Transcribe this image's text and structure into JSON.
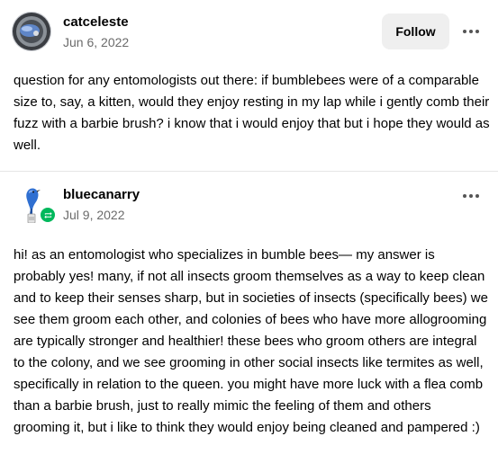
{
  "posts": [
    {
      "username": "catceleste",
      "date": "Jun 6, 2022",
      "follow_label": "Follow",
      "body": "question for any entomologists out there: if bumblebees were of a comparable size to, say, a kitten, would they enjoy resting in my lap while i gently comb their fuzz with a barbie brush? i know that i would enjoy that but i hope they would as well."
    },
    {
      "username": "bluecanarry",
      "date": "Jul 9, 2022",
      "body": "hi! as an entomologist who specializes in bumble bees— my answer is probably yes! many, if not all insects groom themselves as a way to keep clean and to keep their senses sharp, but in societies of insects (specifically bees) we see them groom each other, and colonies of bees who have more allogrooming are typically stronger and healthier! these bees who groom others are integral to the colony, and we see grooming in other social insects like termites as well, specifically in relation to the queen. you might have more luck with a flea comb than a barbie brush, just to really mimic the feeling of them and others grooming it, but i like to think they would enjoy being cleaned and pampered :)"
    }
  ],
  "icons": {
    "more": "more-horizontal-icon",
    "reblog": "reblog-icon"
  },
  "colors": {
    "reblog_badge": "#00b85c",
    "follow_button_bg": "#efefef",
    "date_text": "#6b6b6b"
  }
}
